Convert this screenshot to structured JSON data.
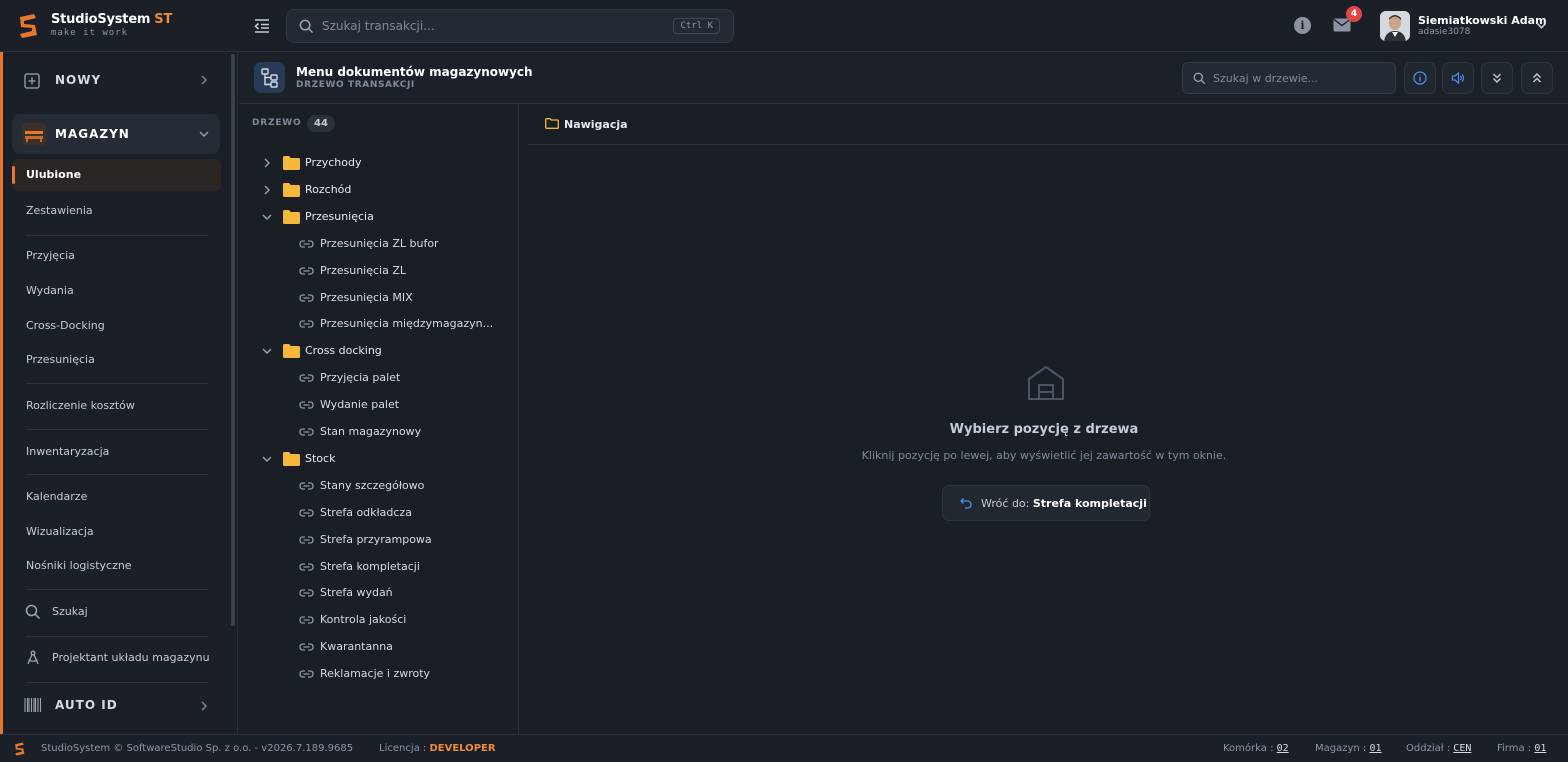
{
  "app": {
    "brand_name": "StudioSystem",
    "brand_suffix": "ST",
    "tagline": "make it work",
    "accent_color": "#e8772e"
  },
  "topbar": {
    "search_placeholder": "Szukaj transakcji...",
    "search_shortcut": "Ctrl K",
    "info_icon": "info-icon",
    "mail_icon": "mail-icon",
    "mail_badge": "4",
    "user_name": "Siemiatkowski Adam",
    "user_login": "adasie3078"
  },
  "sidebar": {
    "new_label": "NOWY",
    "module_label": "MAGAZYN",
    "favorites_label": "Ulubione",
    "items": [
      {
        "label": "Zestawienia"
      },
      {
        "label": "Przyjęcia"
      },
      {
        "label": "Wydania"
      },
      {
        "label": "Cross-Docking"
      },
      {
        "label": "Przesunięcia"
      },
      {
        "label": "Rozliczenie kosztów"
      },
      {
        "label": "Inwentaryzacja"
      },
      {
        "label": "Kalendarze"
      },
      {
        "label": "Wizualizacja"
      },
      {
        "label": "Nośniki logistyczne"
      }
    ],
    "search_label": "Szukaj",
    "designer_label": "Projektant układu magazynu",
    "autoid_label": "AUTO ID"
  },
  "header": {
    "title": "Menu dokumentów magazynowych",
    "subtitle": "DRZEWO TRANSAKCJI",
    "tree_search_placeholder": "Szukaj w drzewie..."
  },
  "tree": {
    "label": "DRZEWO",
    "count": "44",
    "nodes": [
      {
        "type": "folder",
        "label": "Przychody",
        "expanded": false
      },
      {
        "type": "folder",
        "label": "Rozchód",
        "expanded": false
      },
      {
        "type": "folder",
        "label": "Przesunięcia",
        "expanded": true
      },
      {
        "type": "link",
        "label": "Przesunięcia ZL bufor"
      },
      {
        "type": "link",
        "label": "Przesunięcia ZL"
      },
      {
        "type": "link",
        "label": "Przesunięcia MIX"
      },
      {
        "type": "link",
        "label": "Przesunięcia międzymagazyn..."
      },
      {
        "type": "folder",
        "label": "Cross docking",
        "expanded": true
      },
      {
        "type": "link",
        "label": "Przyjęcia palet"
      },
      {
        "type": "link",
        "label": "Wydanie palet"
      },
      {
        "type": "link",
        "label": "Stan magazynowy"
      },
      {
        "type": "folder",
        "label": "Stock",
        "expanded": true
      },
      {
        "type": "link",
        "label": "Stany szczegółowo"
      },
      {
        "type": "link",
        "label": "Strefa odkładcza"
      },
      {
        "type": "link",
        "label": "Strefa przyrampowa"
      },
      {
        "type": "link",
        "label": "Strefa kompletacji"
      },
      {
        "type": "link",
        "label": "Strefa wydań"
      },
      {
        "type": "link",
        "label": "Kontrola jakości"
      },
      {
        "type": "link",
        "label": "Kwarantanna"
      },
      {
        "type": "link",
        "label": "Reklamacje i zwroty"
      }
    ]
  },
  "content": {
    "nav_label": "Nawigacja",
    "empty_title": "Wybierz pozycję z drzewa",
    "empty_subtitle": "Kliknij pozycję po lewej, aby wyświetlić jej zawartość w tym oknie.",
    "back_prefix": "Wróć do: ",
    "back_target": "Strefa kompletacji"
  },
  "footer": {
    "copyright": "StudioSystem © SoftwareStudio Sp. z o.o. - v2026.7.189.9685",
    "license_label": "Licencja : ",
    "license_value": "DEVELOPER",
    "cell_label": "Komórka : ",
    "cell_value": "02",
    "warehouse_label": "Magazyn : ",
    "warehouse_value": "01",
    "branch_label": "Oddział : ",
    "branch_value": "CEN",
    "company_label": "Firma : ",
    "company_value": "01"
  }
}
